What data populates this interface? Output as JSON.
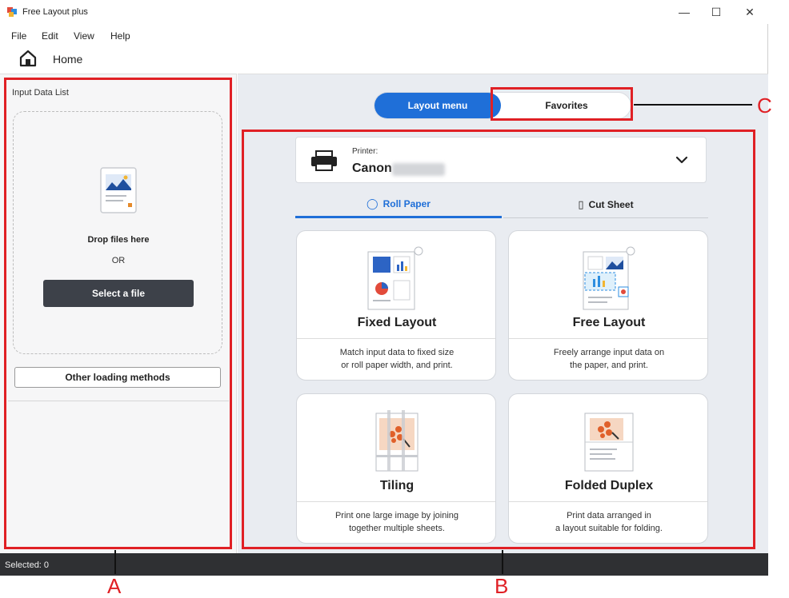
{
  "window": {
    "title": "Free Layout plus",
    "controls": [
      "—",
      "☐",
      "✕"
    ]
  },
  "menu": [
    "File",
    "Edit",
    "View",
    "Help"
  ],
  "home": {
    "label": "Home"
  },
  "input_panel": {
    "title": "Input Data List",
    "drop_text": "Drop files here",
    "or_text": "OR",
    "select_button": "Select a file",
    "other_button": "Other loading methods"
  },
  "top_tabs": {
    "layout_menu": "Layout menu",
    "favorites": "Favorites"
  },
  "printer": {
    "caption": "Printer:",
    "name": "Canon"
  },
  "paper_tabs": {
    "roll": "Roll Paper",
    "cut": "Cut Sheet"
  },
  "cards": [
    {
      "title": "Fixed Layout",
      "desc_line1": "Match input data to fixed size",
      "desc_line2": "or roll paper width, and print."
    },
    {
      "title": "Free Layout",
      "desc_line1": "Freely arrange input data on",
      "desc_line2": "the paper, and print."
    },
    {
      "title": "Tiling",
      "desc_line1": "Print one large image by joining",
      "desc_line2": "together multiple sheets."
    },
    {
      "title": "Folded Duplex",
      "desc_line1": "Print data arranged in",
      "desc_line2": "a layout suitable for folding."
    }
  ],
  "status": {
    "text": "Selected: 0"
  },
  "callouts": {
    "a": "A",
    "b": "B",
    "c": "C"
  },
  "colors": {
    "accent": "#1f6fd8",
    "callout": "#e02025",
    "statusbar": "#2f3033"
  },
  "icons": [
    "app-icon",
    "home-icon",
    "document-icon",
    "printer-icon",
    "chevron-down-icon",
    "roll-paper-icon",
    "cut-sheet-icon"
  ]
}
